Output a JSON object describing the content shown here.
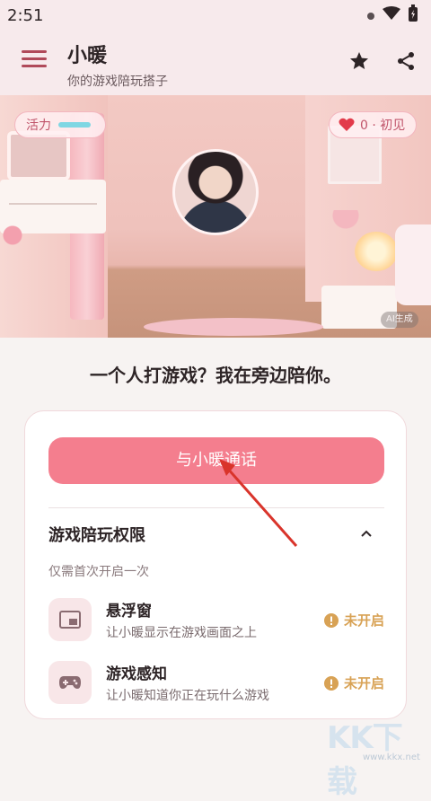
{
  "statusbar": {
    "time": "2:51"
  },
  "appbar": {
    "title": "小暖",
    "subtitle": "你的游戏陪玩搭子"
  },
  "hero": {
    "energy_label": "活力",
    "energy_level": 0.8,
    "affection_text": "0 · 初见",
    "ai_badge": "AI生成"
  },
  "tagline": "一个人打游戏？我在旁边陪你。",
  "card": {
    "call_button": "与小暖通话",
    "permissions_title": "游戏陪玩权限",
    "permissions_note": "仅需首次开启一次",
    "permissions": [
      {
        "name": "悬浮窗",
        "desc": "让小暖显示在游戏画面之上",
        "status": "未开启",
        "icon": "floating-window-icon"
      },
      {
        "name": "游戏感知",
        "desc": "让小暖知道你正在玩什么游戏",
        "status": "未开启",
        "icon": "gamepad-icon"
      }
    ]
  },
  "watermark": {
    "main": "KK下载",
    "sub": "www.kkx.net"
  },
  "colors": {
    "accent": "#f47e8e",
    "header_bg": "#f7eaec",
    "warning": "#d8a255",
    "annotation_arrow": "#d9342b"
  }
}
